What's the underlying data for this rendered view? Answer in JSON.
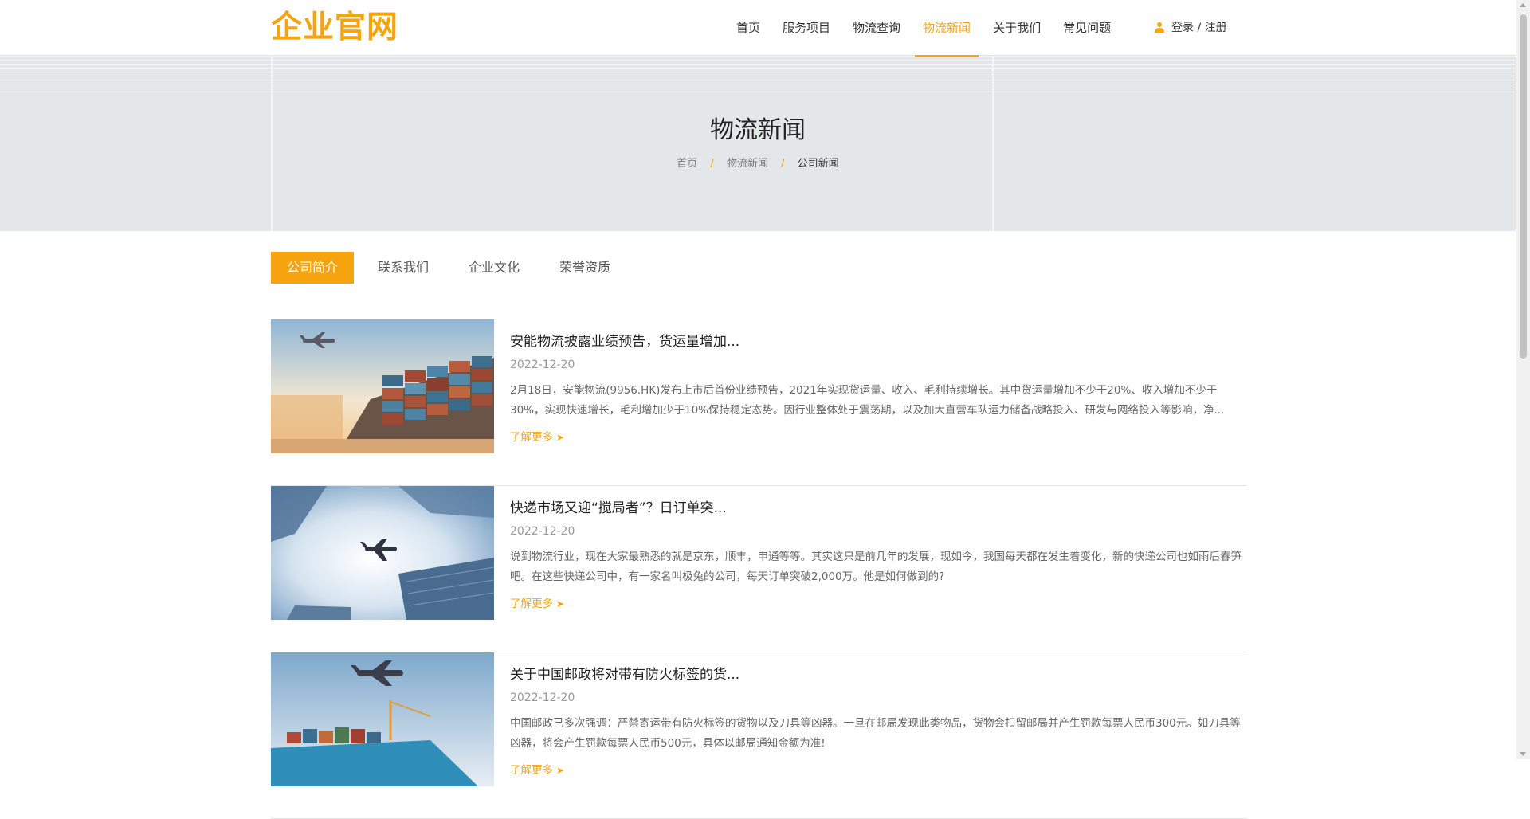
{
  "brand": {
    "logo_text": "企业官网",
    "accent_color": "#f5a40f"
  },
  "nav": {
    "items": [
      {
        "label": "首页",
        "active": false
      },
      {
        "label": "服务项目",
        "active": false
      },
      {
        "label": "物流查询",
        "active": false
      },
      {
        "label": "物流新闻",
        "active": true
      },
      {
        "label": "关于我们",
        "active": false
      },
      {
        "label": "常见问题",
        "active": false
      }
    ],
    "login_label": "登录 / 注册",
    "login_icon": "user-icon"
  },
  "banner": {
    "title": "物流新闻",
    "breadcrumb": [
      {
        "label": "首页"
      },
      {
        "label": "物流新闻"
      },
      {
        "label": "公司新闻"
      }
    ],
    "separator": "/"
  },
  "tabs": [
    {
      "label": "公司简介",
      "active": true
    },
    {
      "label": "联系我们",
      "active": false
    },
    {
      "label": "企业文化",
      "active": false
    },
    {
      "label": "荣誉资质",
      "active": false
    }
  ],
  "news": [
    {
      "title": "安能物流披露业绩预告，货运量增加...",
      "date": "2022-12-20",
      "summary": "2月18日，安能物流(9956.HK)发布上市后首份业绩预告，2021年实现货运量、收入、毛利持续增长。其中货运量增加不少于20%、收入增加不少于30%，实现快速增长，毛利增加少于10%保持稳定态势。因行业整体处于震荡期，以及加大直营车队运力储备战略投入、研发与网络投入等影响，净...",
      "read_more": "了解更多",
      "image_icon": "cargo-containers-airplane-image"
    },
    {
      "title": "快递市场又迎“搅局者”？日订单突...",
      "date": "2022-12-20",
      "summary": "说到物流行业，现在大家最熟悉的就是京东，顺丰，申通等等。其实这只是前几年的发展，现如今，我国每天都在发生着变化，新的快递公司也如雨后春笋吧。在这些快递公司中，有一家名叫极兔的公司，每天订单突破2,000万。他是如何做到的?",
      "read_more": "了解更多",
      "image_icon": "airplane-skyscrapers-image"
    },
    {
      "title": "关于中国邮政将对带有防火标签的货...",
      "date": "2022-12-20",
      "summary": "中国邮政已多次强调：严禁寄运带有防火标签的货物以及刀具等凶器。一旦在邮局发现此类物品，货物会扣留邮局并产生罚款每票人民币300元。如刀具等凶器，将会产生罚款每票人民币500元，具体以邮局通知金额为准!",
      "read_more": "了解更多",
      "image_icon": "cargo-ship-airplane-image"
    }
  ]
}
